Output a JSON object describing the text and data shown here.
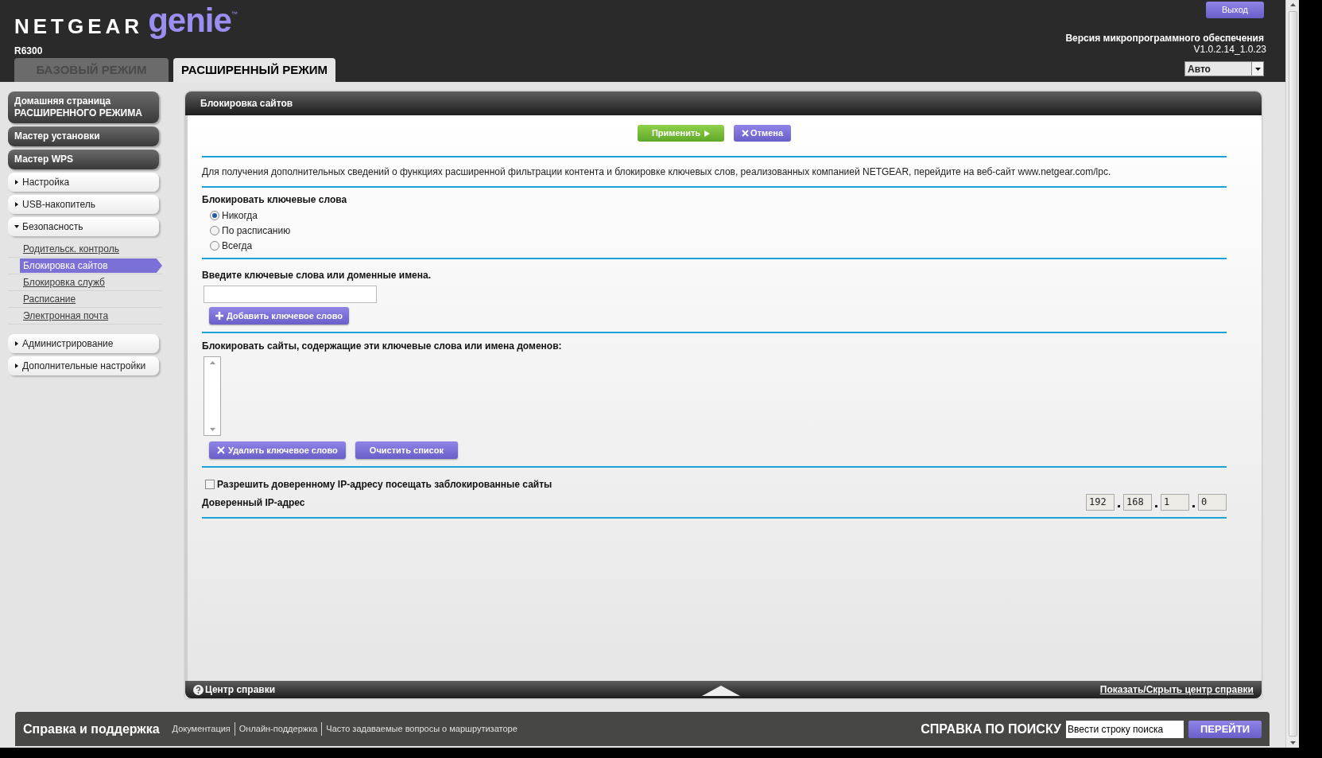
{
  "header": {
    "logo": {
      "brand": "NETGEAR",
      "product": "genie",
      "mark": "™"
    },
    "model": "R6300",
    "logout": "Выход",
    "firmware_label": "Версия микропрограммного обеспечения",
    "firmware_version": "V1.0.2.14_1.0.23",
    "language": "Авто"
  },
  "tabs": [
    {
      "label": "БАЗОВЫЙ РЕЖИМ",
      "selected": false
    },
    {
      "label": "РАСШИРЕННЫЙ РЕЖИМ",
      "selected": true
    }
  ],
  "sidebar": {
    "items": [
      {
        "kind": "dark",
        "label": "Домашняя страница РАСШИРЕННОГО РЕЖИМА"
      },
      {
        "kind": "dark",
        "label": "Мастер установки"
      },
      {
        "kind": "dark",
        "label": "Мастер WPS"
      },
      {
        "kind": "section",
        "label": "Настройка",
        "expanded": false
      },
      {
        "kind": "section",
        "label": "USB-накопитель",
        "expanded": false
      },
      {
        "kind": "section",
        "label": "Безопасность",
        "expanded": true,
        "children": [
          {
            "label": "Родительск. контроль",
            "selected": false
          },
          {
            "label": "Блокировка сайтов",
            "selected": true
          },
          {
            "label": "Блокировка служб",
            "selected": false
          },
          {
            "label": "Расписание",
            "selected": false
          },
          {
            "label": "Электронная почта",
            "selected": false
          }
        ]
      },
      {
        "kind": "section",
        "label": "Администрирование",
        "expanded": false
      },
      {
        "kind": "section",
        "label": "Дополнительные настройки",
        "expanded": false
      }
    ]
  },
  "panel": {
    "title": "Блокировка сайтов",
    "apply": "Применить",
    "cancel": "Отмена",
    "info": "Для получения дополнительных сведений о функциях расширенной фильтрации контента и блокировке ключевых слов, реализованных компанией NETGEAR, перейдите на веб-сайт www.netgear.com/lpc.",
    "block_label": "Блокировать ключевые слова",
    "block_options": [
      {
        "label": "Никогда",
        "selected": true
      },
      {
        "label": "По расписанию",
        "selected": false
      },
      {
        "label": "Всегда",
        "selected": false
      }
    ],
    "keyword_label": "Введите ключевые слова или доменные имена.",
    "add_keyword": "Добавить ключевое слово",
    "list_label": "Блокировать сайты, содержащие эти ключевые слова или имена доменов:",
    "delete_keyword": "Удалить ключевое слово",
    "clear_list": "Очистить список",
    "allow_trusted": {
      "label": "Разрешить доверенному IP-адресу посещать заблокированные сайты",
      "checked": false
    },
    "trusted_ip_label": "Доверенный IP-адрес",
    "trusted_ip": [
      "192",
      "168",
      "1",
      "0"
    ]
  },
  "help_bar": {
    "title": "Центр справки",
    "toggle": "Показать/Скрыть центр справки"
  },
  "footer": {
    "title": "Справка и поддержка",
    "links": [
      "Документация",
      "Онлайн-поддержка",
      "Часто задаваемые вопросы о маршрутизаторе"
    ],
    "search_label": "СПРАВКА ПО ПОИСКУ",
    "search_value": "Ввести строку поиска",
    "go": "ПЕРЕЙТИ"
  }
}
